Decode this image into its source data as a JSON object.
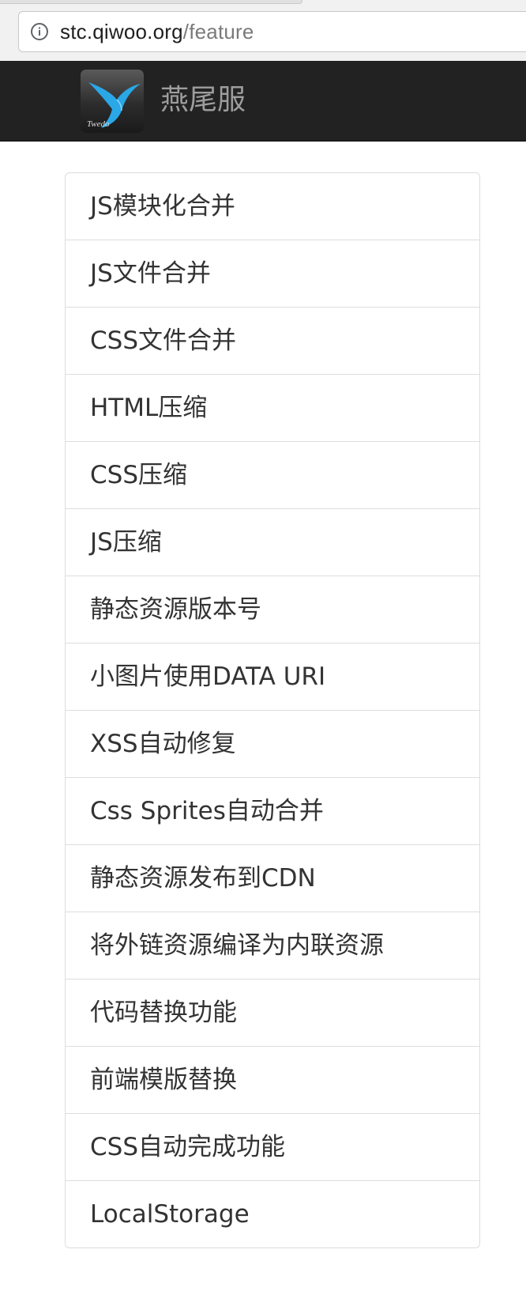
{
  "browser": {
    "url_host": "stc.qiwoo.org",
    "url_path": "/feature",
    "info_icon": "info-circle-icon"
  },
  "navbar": {
    "brand_name": "燕尾服",
    "logo_text": "Twedo",
    "logo_icon": "swallow-bird-icon",
    "colors": {
      "background": "#222222",
      "brand_text": "#9d9d9d",
      "logo_bird": "#2aa7e6"
    }
  },
  "features": [
    {
      "label": "JS模块化合并"
    },
    {
      "label": "JS文件合并"
    },
    {
      "label": "CSS文件合并"
    },
    {
      "label": "HTML压缩"
    },
    {
      "label": "CSS压缩"
    },
    {
      "label": "JS压缩"
    },
    {
      "label": "静态资源版本号"
    },
    {
      "label": "小图片使用DATA URI"
    },
    {
      "label": "XSS自动修复"
    },
    {
      "label": "Css Sprites自动合并"
    },
    {
      "label": "静态资源发布到CDN"
    },
    {
      "label": "将外链资源编译为内联资源"
    },
    {
      "label": "代码替换功能"
    },
    {
      "label": "前端模版替换"
    },
    {
      "label": "CSS自动完成功能"
    },
    {
      "label": "LocalStorage"
    }
  ]
}
